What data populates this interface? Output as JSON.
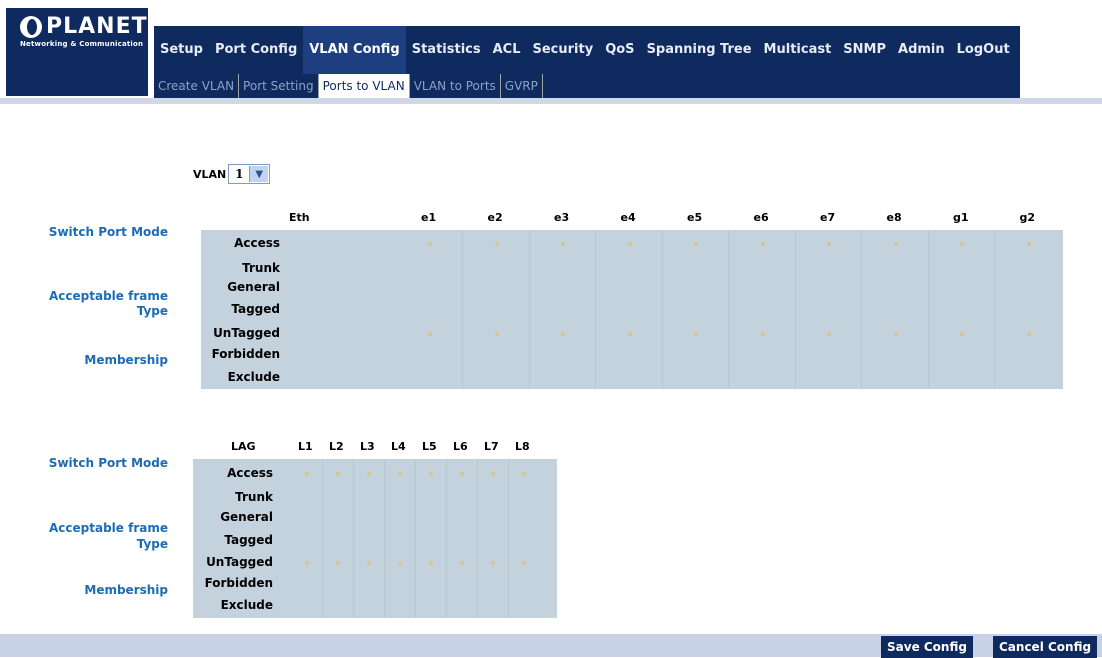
{
  "brand": {
    "name": "PLANET",
    "tagline": "Networking & Communication"
  },
  "nav": [
    "Setup",
    "Port Config",
    "VLAN Config",
    "Statistics",
    "ACL",
    "Security",
    "QoS",
    "Spanning Tree",
    "Multicast",
    "SNMP",
    "Admin",
    "LogOut"
  ],
  "nav_active": "VLAN Config",
  "subnav": [
    "Create VLAN",
    "Port Setting",
    "Ports to VLAN",
    "VLAN to Ports",
    "GVRP"
  ],
  "subnav_active": "Ports to VLAN",
  "vlan": {
    "label": "VLAN",
    "value": "1"
  },
  "eth_table": {
    "title": "Eth",
    "ports": [
      "e1",
      "e2",
      "e3",
      "e4",
      "e5",
      "e6",
      "e7",
      "e8",
      "g1",
      "g2"
    ],
    "section_labels": [
      "Switch Port Mode",
      "Acceptable frame",
      "Type",
      "Membership"
    ],
    "rows": [
      "Access",
      "Trunk",
      "General",
      "Tagged",
      "UnTagged",
      "Forbidden",
      "Exclude"
    ]
  },
  "lag_table": {
    "title": "LAG",
    "ports": [
      "L1",
      "L2",
      "L3",
      "L4",
      "L5",
      "L6",
      "L7",
      "L8"
    ],
    "section_labels": [
      "Switch Port Mode",
      "Acceptable frame",
      "Type",
      "Membership"
    ],
    "rows": [
      "Access",
      "Trunk",
      "General",
      "Tagged",
      "UnTagged",
      "Forbidden",
      "Exclude"
    ]
  },
  "buttons": {
    "save": "Save Config",
    "cancel": "Cancel Config"
  }
}
